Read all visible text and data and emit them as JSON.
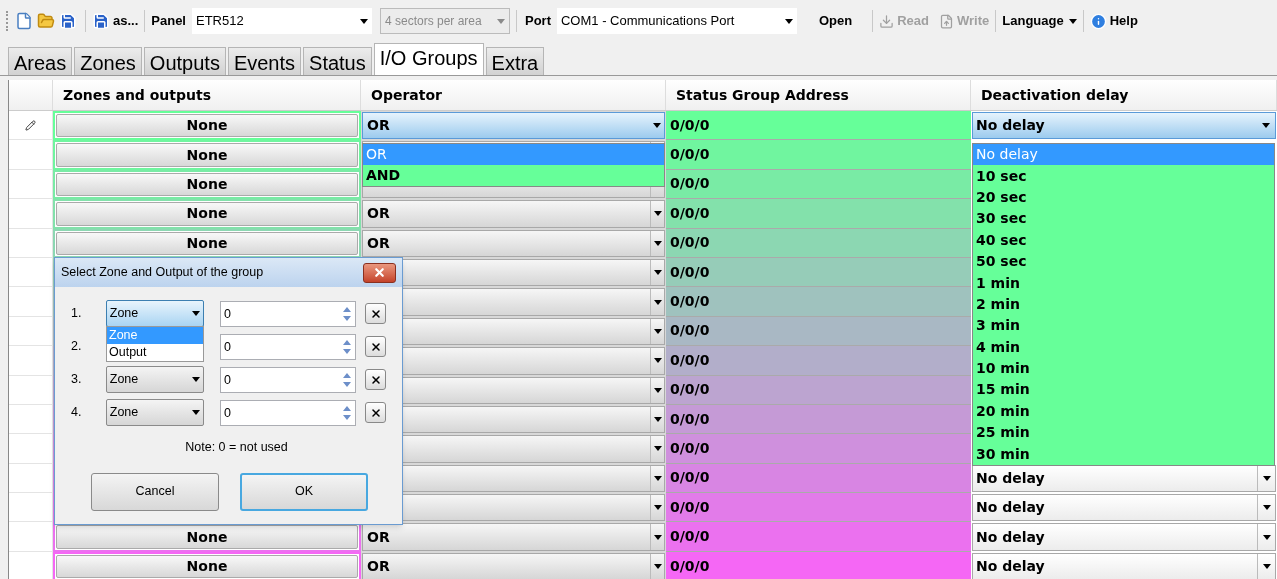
{
  "toolbar": {
    "save_as": {
      "label": "as..."
    },
    "panel": {
      "label": "Panel",
      "value": "ETR512"
    },
    "sectors": {
      "value": "4 sectors per area",
      "disabled": true
    },
    "port": {
      "label": "Port",
      "value": "COM1 - Communications Port"
    },
    "open": {
      "label": "Open"
    },
    "read": {
      "label": "Read",
      "disabled": true
    },
    "write": {
      "label": "Write",
      "disabled": true
    },
    "language": {
      "label": "Language"
    },
    "help": {
      "label": "Help"
    }
  },
  "tabs": [
    {
      "label": "Areas",
      "selected": false
    },
    {
      "label": "Zones",
      "selected": false
    },
    {
      "label": "Outputs",
      "selected": false
    },
    {
      "label": "Events",
      "selected": false
    },
    {
      "label": "Status",
      "selected": false
    },
    {
      "label": "I/O Groups",
      "selected": true
    },
    {
      "label": "Extra",
      "selected": false
    }
  ],
  "table": {
    "columns": [
      "Zones and outputs",
      "Operator",
      "Status Group Address",
      "Deactivation delay"
    ],
    "rows": [
      {
        "selected": true,
        "zones": "None",
        "operator": "OR",
        "address": "0/0/0",
        "delay": "No delay",
        "color": "#66ff99"
      },
      {
        "selected": false,
        "zones": "None",
        "address": "0/0/0",
        "color": "#70f59f"
      },
      {
        "selected": false,
        "zones": "None",
        "address": "0/0/0",
        "color": "#79eba5"
      },
      {
        "selected": false,
        "zones": "None",
        "operator": "OR",
        "address": "0/0/0",
        "color": "#83e1ab"
      },
      {
        "selected": false,
        "zones": "None",
        "operator": "OR",
        "address": "0/0/0",
        "color": "#8cd7b2"
      },
      {
        "selected": false,
        "address": "0/0/0",
        "color": "#96ccb8"
      },
      {
        "selected": false,
        "address": "0/0/0",
        "color": "#9fc2be"
      },
      {
        "selected": false,
        "address": "0/0/0",
        "color": "#a9b8c4"
      },
      {
        "selected": false,
        "address": "0/0/0",
        "color": "#b2aeca"
      },
      {
        "selected": false,
        "address": "0/0/0",
        "color": "#bca4d0"
      },
      {
        "selected": false,
        "address": "0/0/0",
        "color": "#c59ad6"
      },
      {
        "selected": false,
        "address": "0/0/0",
        "color": "#cf90dd"
      },
      {
        "selected": false,
        "address": "0/0/0",
        "delay": "No delay",
        "color": "#d885e3"
      },
      {
        "selected": false,
        "address": "0/0/0",
        "delay": "No delay",
        "color": "#e27be9"
      },
      {
        "selected": false,
        "zones": "None",
        "operator": "OR",
        "address": "0/0/0",
        "delay": "No delay",
        "color": "#eb71ef"
      },
      {
        "selected": false,
        "zones": "None",
        "operator": "OR",
        "address": "0/0/0",
        "delay": "No delay",
        "color": "#f567f5"
      }
    ]
  },
  "operator_dropdown": {
    "options": [
      {
        "label": "OR",
        "selected": true
      },
      {
        "label": "AND",
        "selected": false
      }
    ]
  },
  "delay_dropdown": {
    "options": [
      {
        "label": "No delay",
        "selected": true
      },
      {
        "label": "10 sec",
        "selected": false
      },
      {
        "label": "20 sec",
        "selected": false
      },
      {
        "label": "30 sec",
        "selected": false
      },
      {
        "label": "40 sec",
        "selected": false
      },
      {
        "label": "50 sec",
        "selected": false
      },
      {
        "label": "1 min",
        "selected": false
      },
      {
        "label": "2 min",
        "selected": false
      },
      {
        "label": "3 min",
        "selected": false
      },
      {
        "label": "4 min",
        "selected": false
      },
      {
        "label": "10 min",
        "selected": false
      },
      {
        "label": "15 min",
        "selected": false
      },
      {
        "label": "20 min",
        "selected": false
      },
      {
        "label": "25 min",
        "selected": false
      },
      {
        "label": "30 min",
        "selected": false
      }
    ]
  },
  "dialog": {
    "title": "Select Zone and Output of the group",
    "items": [
      {
        "number": "1.",
        "type": "Zone",
        "value": "0",
        "options": [
          {
            "label": "Zone",
            "selected": true
          },
          {
            "label": "Output",
            "selected": false
          }
        ]
      },
      {
        "number": "2.",
        "value": "0"
      },
      {
        "number": "3.",
        "type": "Zone",
        "value": "0"
      },
      {
        "number": "4.",
        "type": "Zone",
        "value": "0"
      }
    ],
    "note": "Note: 0 = not used",
    "cancel": "Cancel",
    "ok": "OK"
  }
}
